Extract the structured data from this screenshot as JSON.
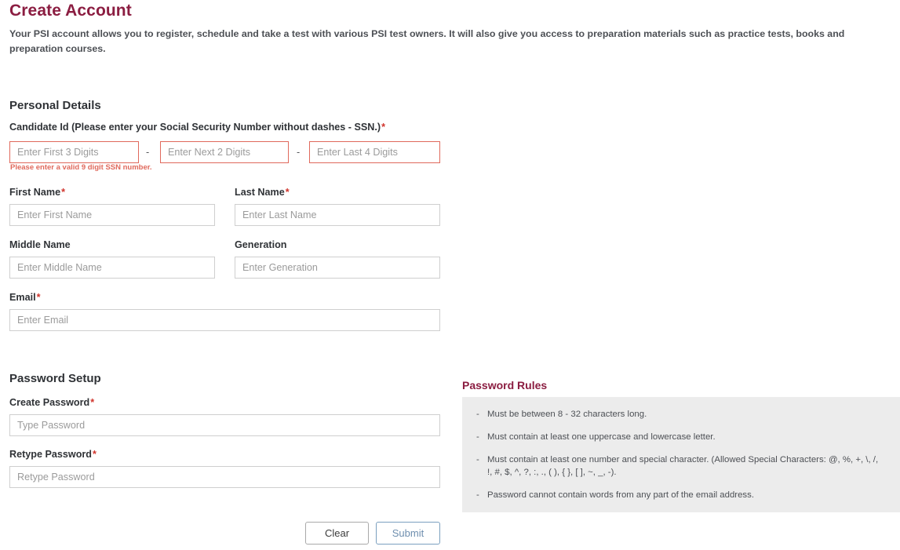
{
  "header": {
    "title": "Create Account",
    "intro": "Your PSI account allows you to register, schedule and take a test with various PSI test owners. It will also give you access to preparation materials such as practice tests, books and preparation courses."
  },
  "sections": {
    "personal_details": "Personal Details",
    "password_setup": "Password Setup",
    "password_rules": "Password Rules"
  },
  "form": {
    "ssn": {
      "label": "Candidate Id (Please enter your Social Security Number without dashes - SSN.)",
      "required_marker": "*",
      "separator": "-",
      "part1_placeholder": "Enter First 3 Digits",
      "part2_placeholder": "Enter Next 2 Digits",
      "part3_placeholder": "Enter Last 4 Digits",
      "part1_value": "",
      "part2_value": "",
      "part3_value": "",
      "error": "Please enter a valid 9 digit SSN number."
    },
    "first_name": {
      "label": "First Name",
      "required_marker": "*",
      "placeholder": "Enter First Name",
      "value": ""
    },
    "last_name": {
      "label": "Last Name",
      "required_marker": "*",
      "placeholder": "Enter Last Name",
      "value": ""
    },
    "middle_name": {
      "label": "Middle Name",
      "placeholder": "Enter Middle Name",
      "value": ""
    },
    "generation": {
      "label": "Generation",
      "placeholder": "Enter Generation",
      "value": ""
    },
    "email": {
      "label": "Email",
      "required_marker": "*",
      "placeholder": "Enter Email",
      "value": ""
    },
    "create_password": {
      "label": "Create Password",
      "required_marker": "*",
      "placeholder": "Type Password",
      "value": ""
    },
    "retype_password": {
      "label": "Retype Password",
      "required_marker": "*",
      "placeholder": "Retype Password",
      "value": ""
    }
  },
  "password_rules": {
    "bullet": "-",
    "items": [
      "Must be between 8 - 32 characters long.",
      "Must contain at least one uppercase and lowercase letter.",
      "Must contain at least one number and special character. (Allowed Special Characters: @, %, +, \\, /, !, #, $, ^, ?, :, ., ( ), { }, [ ], ~, _, -).",
      "Password cannot contain words from any part of the email address."
    ]
  },
  "buttons": {
    "clear": "Clear",
    "submit": "Submit"
  },
  "colors": {
    "brand_maroon": "#8b1d41",
    "required_red": "#d0342c",
    "error_red": "#e0695c",
    "rules_box_bg": "#ececec",
    "submit_blue": "#6f8faf",
    "text_dark": "#2f3236"
  }
}
